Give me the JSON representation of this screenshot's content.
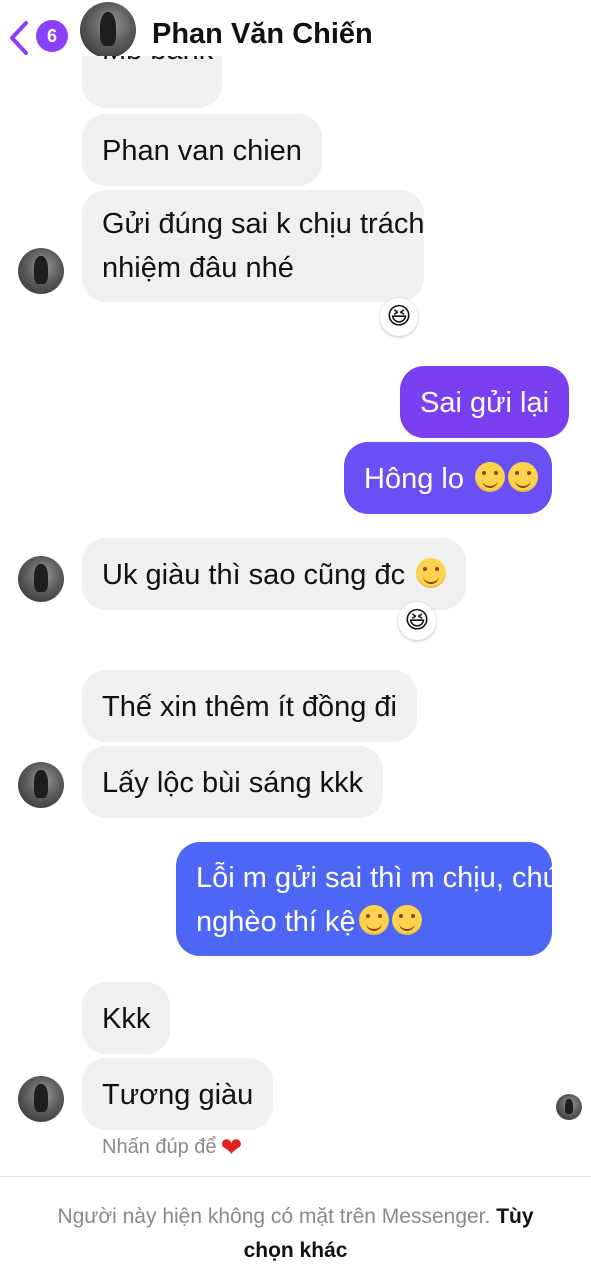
{
  "header": {
    "back_count": "6",
    "contact_name": "Phan Văn Chiến",
    "accent": "#8a3ffc"
  },
  "messages": {
    "m0_partial": "Mb bank",
    "m1": "Phan van chien",
    "m2_line1": "Gửi đúng sai k chịu trách",
    "m2_line2": "nhiệm đâu nhé",
    "m3": "Sai gửi lại",
    "m4": "Hông lo",
    "m5": "Uk giàu thì sao cũng đc",
    "m6": "Thế xin thêm ít đồng đi",
    "m7": "Lấy lộc bùi sáng kkk",
    "m8_line1": "Lỗi m gửi sai thì m chịu, chứ",
    "m8_line2": "nghèo thí kệ",
    "m9": "Kkk",
    "m10": "Tương giàu"
  },
  "reactions": {
    "r1": "😆",
    "r2": "😆"
  },
  "hint": {
    "text": "Nhấn đúp để",
    "heart": "❤"
  },
  "footer": {
    "status_text": "Người này hiện không có mặt trên Messenger.",
    "link": "Tùy chọn khác"
  },
  "colors": {
    "incoming_bubble": "#f0f0f0",
    "outgoing_purple": "#7b3ff2",
    "outgoing_violet": "#6a4ff4",
    "outgoing_blue": "#4d66f5"
  },
  "icons": [
    "back-chevron-icon",
    "avatar",
    "smiling-face-icon",
    "laughing-reaction-icon",
    "heart-icon"
  ]
}
